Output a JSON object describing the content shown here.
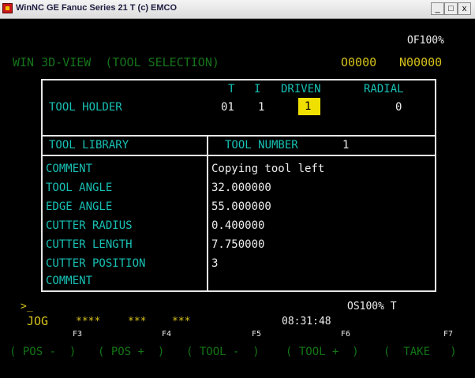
{
  "window": {
    "title": "WinNC GE Fanuc Series 21 T (c) EMCO",
    "minimize": "_",
    "maximize": "□",
    "close": "x"
  },
  "status": {
    "feed_override": "OF100%",
    "mode_title": "WIN 3D-VIEW  (TOOL SELECTION)",
    "program": "O0000",
    "block": "N00000"
  },
  "holder": {
    "label": "TOOL HOLDER",
    "col_t": "T",
    "col_i": "I",
    "col_driven": "DRIVEN",
    "col_radial": "RADIAL",
    "val_t": "01",
    "val_i": "1",
    "val_driven": "1",
    "val_radial": "0"
  },
  "library": {
    "label": "TOOL LIBRARY",
    "number_label": "TOOL NUMBER",
    "number_value": "1"
  },
  "params": [
    {
      "label": "COMMENT",
      "value": "Copying tool left"
    },
    {
      "label": "TOOL ANGLE",
      "value": "32.000000"
    },
    {
      "label": "EDGE ANGLE",
      "value": "55.000000"
    },
    {
      "label": "CUTTER RADIUS",
      "value": "0.400000"
    },
    {
      "label": "CUTTER LENGTH",
      "value": "7.750000"
    },
    {
      "label": "CUTTER POSITION",
      "value": "3"
    },
    {
      "label": "COMMENT",
      "value": ""
    }
  ],
  "footer": {
    "prompt": ">_",
    "spindle_override": "OS100% T",
    "mode": "JOG",
    "stars1": "****",
    "stars2": "***",
    "stars3": "***",
    "time": "08:31:48"
  },
  "softkeys": {
    "f3": "F3",
    "f4": "F4",
    "f5": "F5",
    "f6": "F6",
    "f7": "F7",
    "k1": "( POS -  )",
    "k2": "( POS +  )",
    "k3": "( TOOL -  )",
    "k4": "( TOOL +  )",
    "k5": "(  TAKE   )"
  }
}
